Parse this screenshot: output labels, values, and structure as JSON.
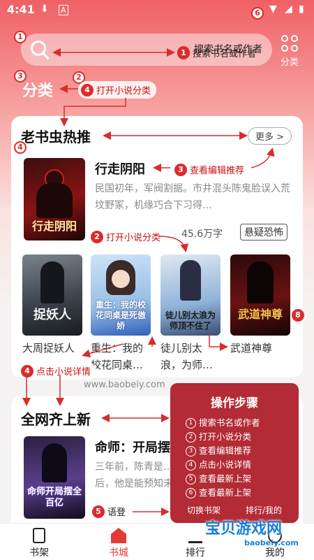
{
  "status": {
    "time": "4:41"
  },
  "header": {
    "search_placeholder": "搜索书名或作者",
    "category_label": "分类"
  },
  "tab_title": "分类",
  "section_editor": {
    "title": "老书虫热推",
    "more": "更多 >",
    "featured": {
      "name": "行走阴阳",
      "desc": "民国初年，军阀割据。市井混头陈鬼脸误入荒坟野冢，机缘巧合下习得…",
      "words": "45.6万字",
      "tag": "悬疑恐怖",
      "cover_text": "行走阴阳"
    },
    "grid": [
      {
        "name": "大周捉妖人",
        "cover_text": "捉妖人"
      },
      {
        "name": "重生：我的校花同桌…",
        "cover_text": "重生：我的校花同桌是死傲娇"
      },
      {
        "name": "徒儿别太浪，为师…",
        "cover_text": "徒儿别太浪为师顶不住了"
      },
      {
        "name": "武道神尊",
        "cover_text": "武道神尊"
      }
    ]
  },
  "url_line": "www.baobeiy.com",
  "section_new": {
    "title": "全网齐上新",
    "featured": {
      "name": "命师：开局摆",
      "desc": "三年前，陈青是…后，他是能预知未",
      "cover_text": "命师开局摆全百亿"
    }
  },
  "annotations": {
    "a1": "搜索书名或作者",
    "a2": "打开小说分类",
    "a3": "查看编辑推荐",
    "a2b": "打开小说分类",
    "a4": "点击小说详情",
    "a5": "语登"
  },
  "steps": {
    "title": "操作步骤",
    "items": [
      "搜索书名或作者",
      "打开小说分类",
      "查看编辑推荐",
      "点击小说详情",
      "查看最新上架",
      "查看最新上架"
    ],
    "footer": "切换书架　　　排行/我的"
  },
  "nav": [
    {
      "label": "书架"
    },
    {
      "label": "书城"
    },
    {
      "label": "排行"
    },
    {
      "label": "我的"
    }
  ],
  "watermark": {
    "title": "宝贝游戏网",
    "url": "baobeiy.com"
  },
  "colors": {
    "accent": "#e53935",
    "annotation": "#d92c2c",
    "steps_bg": "#b22b35"
  }
}
